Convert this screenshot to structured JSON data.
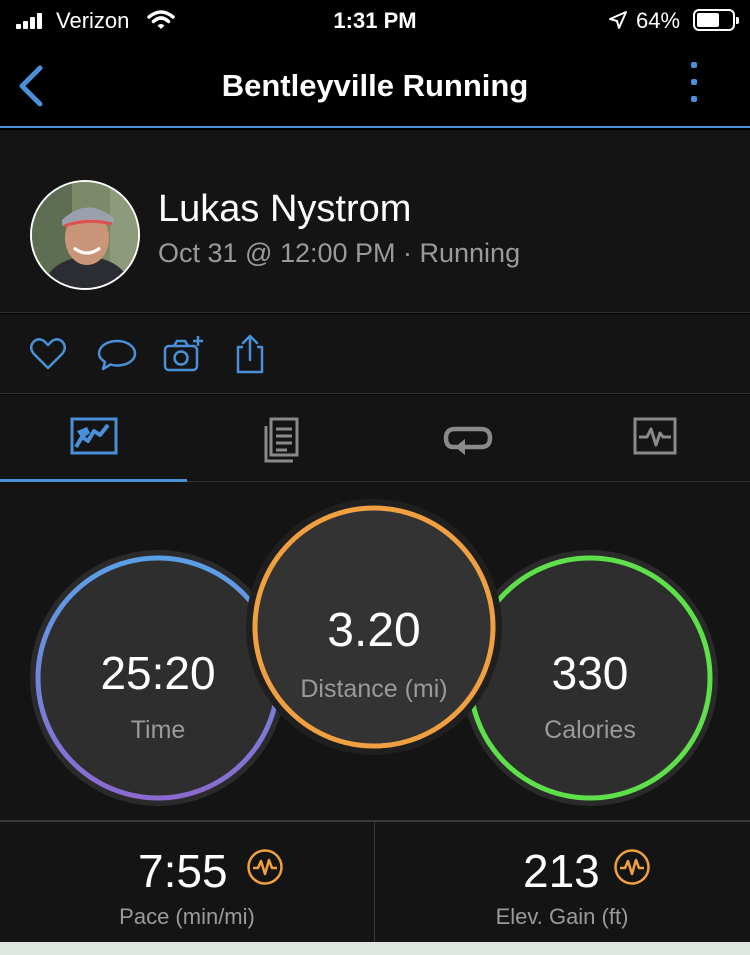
{
  "status_bar": {
    "carrier": "Verizon",
    "time": "1:31 PM",
    "battery_percent": "64%",
    "battery_level": 0.64
  },
  "nav": {
    "title": "Bentleyville Running"
  },
  "profile": {
    "name": "Lukas Nystrom",
    "meta": "Oct 31 @ 12:00 PM · Running"
  },
  "actions": {
    "icons": [
      "heart-icon",
      "comment-icon",
      "camera-add-icon",
      "share-icon"
    ]
  },
  "tabs": {
    "icons": [
      "stats-map-icon",
      "details-list-icon",
      "laps-icon",
      "chart-icon"
    ],
    "active_index": 0
  },
  "stats": {
    "time": {
      "value": "25:20",
      "label": "Time"
    },
    "distance": {
      "value": "3.20",
      "label": "Distance (mi)"
    },
    "calories": {
      "value": "330",
      "label": "Calories"
    }
  },
  "metrics": {
    "pace": {
      "value": "7:55",
      "label": "Pace (min/mi)"
    },
    "elev_gain": {
      "value": "213",
      "label": "Elev. Gain (ft)"
    }
  },
  "colors": {
    "accent": "#4a90d9",
    "distance_ring": "#f0a040",
    "calories_ring": "#5ee04a",
    "time_ring_start": "#5aa0e6",
    "time_ring_end": "#8a6ad0",
    "metric_icon": "#f0a040"
  }
}
